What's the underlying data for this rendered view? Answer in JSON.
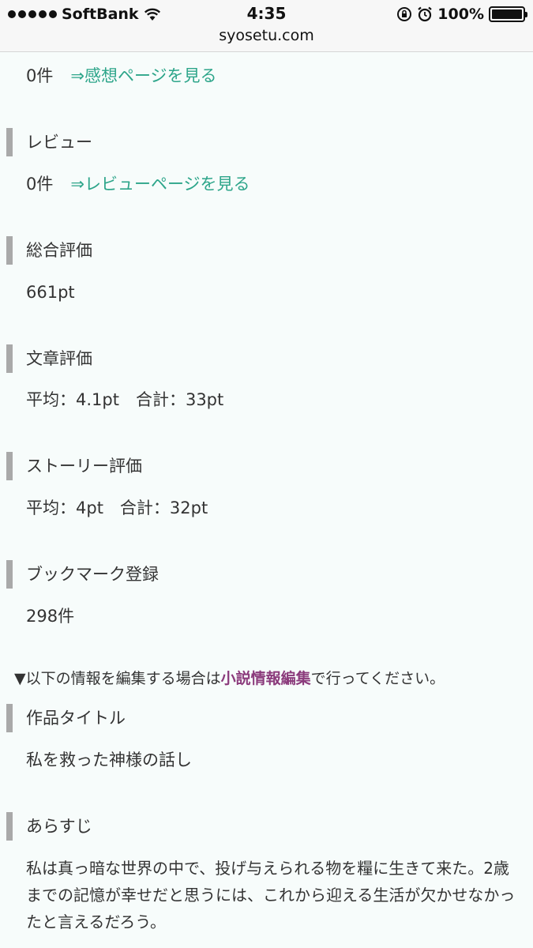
{
  "status_bar": {
    "carrier": "SoftBank",
    "time": "4:35",
    "battery": "100%",
    "battery_level": 1.0,
    "url": "syosetu.com"
  },
  "impressions": {
    "count": "0件",
    "link": "⇒感想ページを見る"
  },
  "review": {
    "heading": "レビュー",
    "count": "0件",
    "link": "⇒レビューページを見る"
  },
  "overall": {
    "heading": "総合評価",
    "value": "661pt"
  },
  "writing": {
    "heading": "文章評価",
    "value": "平均：4.1pt　合計：33pt"
  },
  "story": {
    "heading": "ストーリー評価",
    "value": "平均：4pt　合計：32pt"
  },
  "bookmarks": {
    "heading": "ブックマーク登録",
    "value": "298件"
  },
  "edit_note": {
    "prefix": "▼以下の情報を編集する場合は",
    "link": "小説情報編集",
    "suffix": "で行ってください。"
  },
  "title_section": {
    "heading": "作品タイトル",
    "value": "私を救った神様の話し"
  },
  "synopsis": {
    "heading": "あらすじ",
    "text": "私は真っ暗な世界の中で、投げ与えられる物を糧に生きて来た。2歳までの記憶が幸せだと思うには、これから迎える生活が欠かせなかったと言えるだろう。"
  }
}
